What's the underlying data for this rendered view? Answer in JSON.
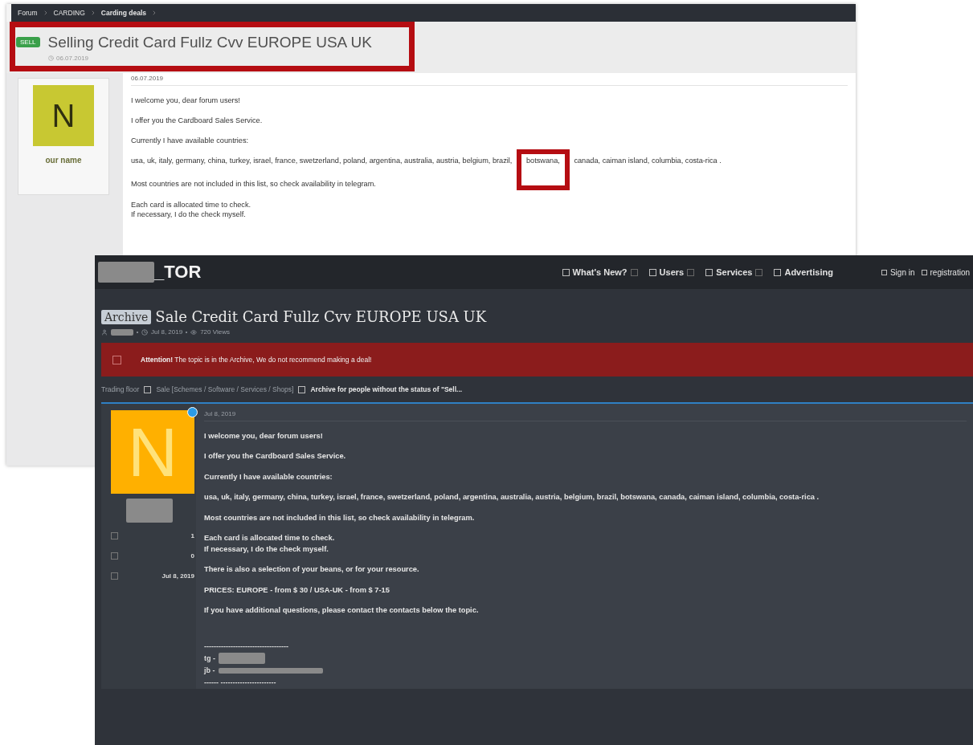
{
  "back_window": {
    "breadcrumb": [
      {
        "label": "Forum",
        "current": false
      },
      {
        "label": "CARDING",
        "current": false
      },
      {
        "label": "Carding deals",
        "current": true
      }
    ],
    "badge": "SELL",
    "title": "Selling Credit Card Fullz Cvv EUROPE USA UK",
    "date": "06.07.2019",
    "title_highlighted": true,
    "user": {
      "initial": "N",
      "name": "our name"
    },
    "post": {
      "date": "06.07.2019",
      "paragraphs": [
        {
          "text": "I welcome you, dear forum users!"
        },
        {
          "text": "I offer you the Cardboard Sales Service."
        },
        {
          "text": "Currently I have available countries:"
        },
        {
          "parts": [
            {
              "text": "usa, uk, italy, germany, china, turkey, israel, france, swetzerland, poland, argentina, australia, austria, belgium, brazil, ",
              "highlighted": false
            },
            {
              "text": "botswana,",
              "highlighted": true
            },
            {
              "text": " canada, caiman island, columbia, costa-rica .",
              "highlighted": false
            }
          ]
        },
        {
          "text": "Most countries are not included in this list, so check availability in telegram."
        },
        {
          "lines": [
            "Each card is allocated time to check.",
            "If necessary, I do the check myself."
          ]
        }
      ]
    }
  },
  "front_window": {
    "logo": "_TOR",
    "nav": [
      {
        "label": "What's New?",
        "has_menu": true
      },
      {
        "label": "Users",
        "has_menu": true
      },
      {
        "label": "Services",
        "has_menu": true
      },
      {
        "label": "Advertising",
        "has_menu": false
      }
    ],
    "account": [
      "Sign in",
      "registration"
    ],
    "badge": "Archive",
    "title": "Sale Credit Card Fullz Cvv EUROPE USA UK",
    "date": "Jul 8, 2019",
    "views": "720 Views",
    "alert": "**Attention!** The topic is in the Archive, We do not recommend making a deal!",
    "breadcrumb": [
      {
        "label": "Trading floor",
        "current": false
      },
      {
        "label": "Sale [Schemes / Software / Services / Shops]",
        "current": false
      },
      {
        "label": "Archive for people without the status of \"Sell...",
        "current": true
      }
    ],
    "user": {
      "initial": "N",
      "stats": [
        "1",
        "0",
        "Jul 8, 2019"
      ]
    },
    "post": {
      "date": "Jul 8, 2019",
      "paragraphs": [
        {
          "lines": [
            "I welcome you, dear forum users!"
          ]
        },
        {
          "lines": [
            "I offer you the Cardboard Sales Service."
          ]
        },
        {
          "lines": [
            "Currently I have available countries:"
          ]
        },
        {
          "lines": [
            "usa, uk, italy, germany, china, turkey, israel, france, swetzerland, poland, argentina, australia, austria, belgium, brazil, botswana, canada, caiman island, columbia, costa-rica ."
          ]
        },
        {
          "lines": [
            "Most countries are not included in this list, so check availability in telegram."
          ]
        },
        {
          "lines": [
            "Each card is allocated time to check.",
            "If necessary, I do the check myself."
          ]
        },
        {
          "lines": [
            "There is also a selection of your beans, or for your resource."
          ]
        },
        {
          "lines": [
            "PRICES: EUROPE - from $ 30 / USA-UK - from $ 7-15"
          ]
        },
        {
          "lines": [
            "If you have additional questions, please contact the contacts below the topic."
          ]
        }
      ],
      "signature": [
        {
          "kind": "rule",
          "text": "-----------------------------------"
        },
        {
          "kind": "contact",
          "text": "tg -"
        },
        {
          "kind": "contact",
          "text": "jb -"
        },
        {
          "kind": "rule",
          "text": "------ -----------------------"
        }
      ]
    }
  }
}
